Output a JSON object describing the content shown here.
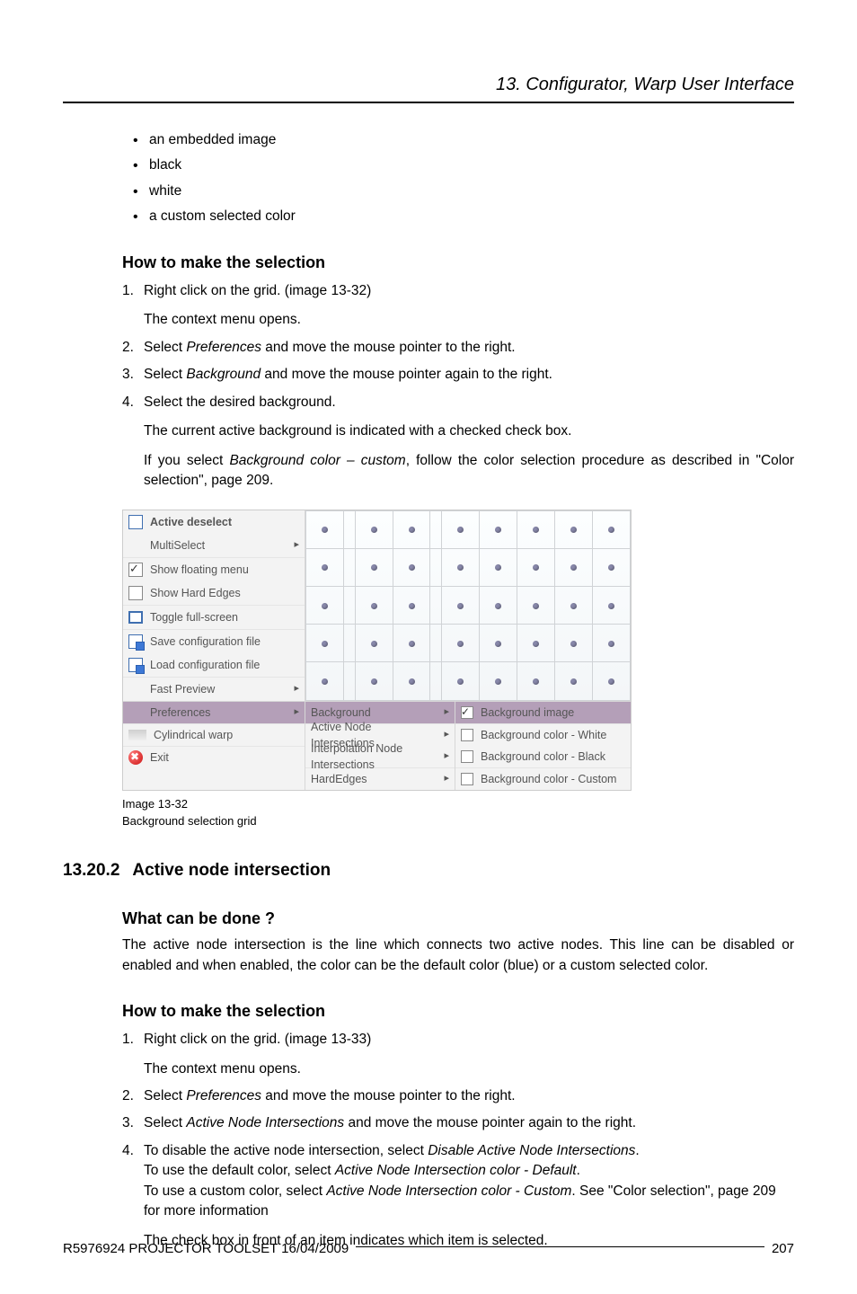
{
  "header": {
    "running": "13.  Configurator, Warp User Interface"
  },
  "bullets": [
    "an embedded image",
    "black",
    "white",
    "a custom selected color"
  ],
  "sec1": {
    "h1": "How to make the selection",
    "steps": [
      {
        "t": "Right click on the grid.  (image 13-32)",
        "sub": "The context menu opens."
      },
      {
        "t": "Select ",
        "i": "Preferences",
        "t2": " and move the mouse pointer to the right."
      },
      {
        "t": "Select ",
        "i": "Background",
        "t2": " and move the mouse pointer again to the right."
      },
      {
        "t": "Select the desired background.",
        "sub": "The current active background is indicated with a checked check box.",
        "sub2a": "If you select ",
        "sub2i": "Background color – custom",
        "sub2b": ", follow the color selection procedure as described in \"Color selection\", page 209."
      }
    ]
  },
  "menu": {
    "items": [
      {
        "label": "Active deselect",
        "bold": true,
        "icon": "crosshair"
      },
      {
        "label": "MultiSelect",
        "indent": true,
        "arrow": true
      },
      {
        "label": "Show floating menu",
        "check": true,
        "checked": true
      },
      {
        "label": "Show Hard Edges",
        "check": true
      },
      {
        "label": "Toggle full-screen",
        "icon": "full"
      },
      {
        "label": "Save configuration file",
        "icon": "save"
      },
      {
        "label": "Load configuration file",
        "icon": "load"
      },
      {
        "label": "Fast Preview",
        "arrow": true
      },
      {
        "label": "Preferences",
        "arrow": true,
        "sel": true
      },
      {
        "label": "Cylindrical warp",
        "icon": "cyl"
      },
      {
        "label": "Exit",
        "icon": "close"
      }
    ],
    "sub_pref": [
      {
        "label": "Background",
        "sel": true,
        "arrow": true
      },
      {
        "label": "Active Node Intersections",
        "arrow": true
      },
      {
        "label": "Interpolation Node Intersections",
        "arrow": true
      },
      {
        "label": "HardEdges",
        "arrow": true
      }
    ],
    "sub_bg": [
      {
        "label": "Background image",
        "checked": true,
        "sel": true
      },
      {
        "label": "Background color - White"
      },
      {
        "label": "Background color - Black"
      },
      {
        "label": "Background color - Custom"
      }
    ]
  },
  "caption": {
    "l1": "Image 13-32",
    "l2": "Background selection grid"
  },
  "sec2": {
    "num": "13.20.2",
    "title": "Active node intersection",
    "q": "What can be done ?",
    "qbody": "The active node intersection is the line which connects two active nodes.  This line can be disabled or enabled and when enabled, the color can be the default color (blue) or a custom selected color.",
    "h": "How to make the selection",
    "steps": [
      {
        "t": "Right click on the grid.  (image 13-33)",
        "sub": "The context menu opens."
      },
      {
        "t": "Select ",
        "i": "Preferences",
        "t2": " and move the mouse pointer to the right."
      },
      {
        "t": "Select ",
        "i": "Active Node Intersections",
        "t2": " and move the mouse pointer again to the right."
      },
      {
        "pre": "To disable the active node intersection, select ",
        "i1": "Disable Active Node Intersections",
        "post1": ".",
        "l2a": "To use the default color, select ",
        "i2": "Active Node Intersection color - Default",
        "l2b": ".",
        "l3a": "To use a custom color, select ",
        "i3": "Active Node Intersection color - Custom",
        "l3b": ".  See \"Color selection\", page 209 for more information",
        "sub": "The check box in front of an item indicates which item is selected."
      }
    ]
  },
  "footer": {
    "left": "R5976924   PROJECTOR TOOLSET  16/04/2009",
    "right": "207"
  }
}
